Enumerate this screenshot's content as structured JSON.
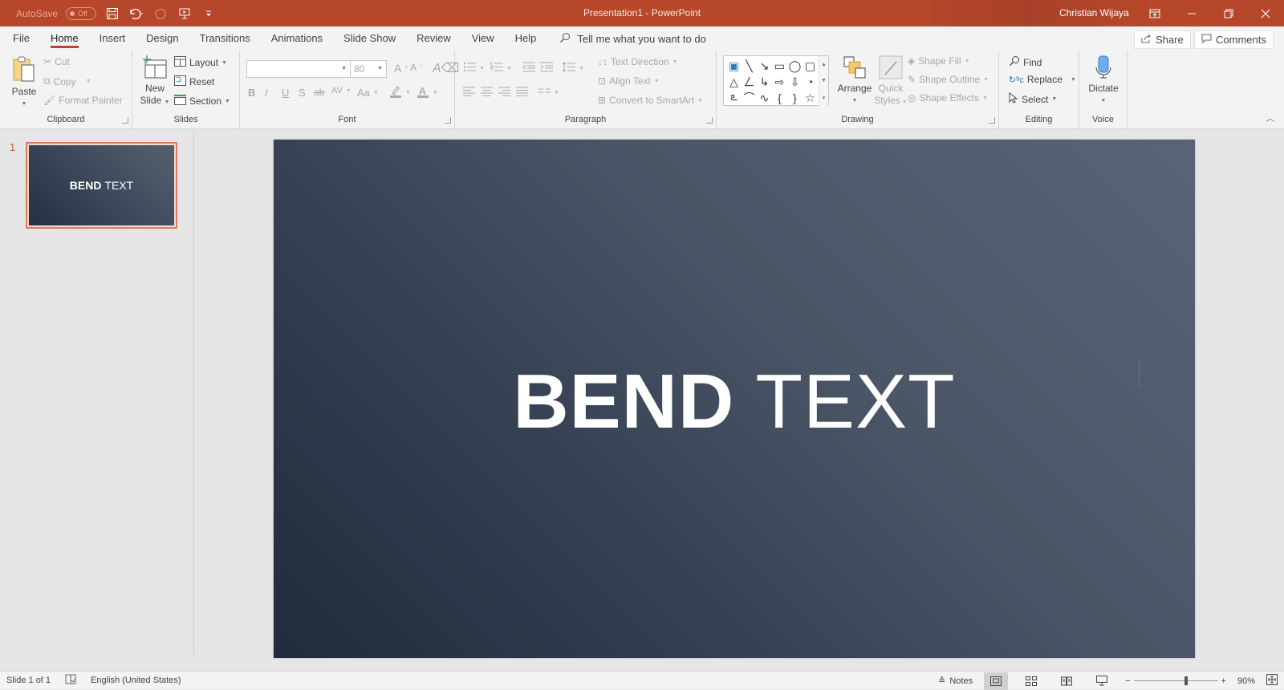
{
  "titlebar": {
    "autosave_label": "AutoSave",
    "autosave_state": "Off",
    "title": "Presentation1  -  PowerPoint",
    "user": "Christian Wijaya",
    "icons": [
      "save-icon",
      "undo-icon",
      "redo-icon",
      "start-from-beginning-icon",
      "customize-qat-icon"
    ],
    "window_controls": [
      "ribbon-display-options-icon",
      "minimize-icon",
      "restore-icon",
      "close-icon"
    ]
  },
  "tabs": [
    {
      "label": "File",
      "active": false
    },
    {
      "label": "Home",
      "active": true
    },
    {
      "label": "Insert",
      "active": false
    },
    {
      "label": "Design",
      "active": false
    },
    {
      "label": "Transitions",
      "active": false
    },
    {
      "label": "Animations",
      "active": false
    },
    {
      "label": "Slide Show",
      "active": false
    },
    {
      "label": "Review",
      "active": false
    },
    {
      "label": "View",
      "active": false
    },
    {
      "label": "Help",
      "active": false
    }
  ],
  "tellme": {
    "placeholder": "Tell me what you want to do"
  },
  "share": {
    "label": "Share"
  },
  "comments": {
    "label": "Comments"
  },
  "ribbon": {
    "clipboard": {
      "label": "Clipboard",
      "paste": "Paste",
      "cut": "Cut",
      "copy": "Copy",
      "format_painter": "Format Painter"
    },
    "slides": {
      "label": "Slides",
      "new_slide_1": "New",
      "new_slide_2": "Slide",
      "layout": "Layout",
      "reset": "Reset",
      "section": "Section"
    },
    "font": {
      "label": "Font",
      "font_name": "",
      "font_size": "80",
      "bold": "B",
      "italic": "I",
      "underline": "U",
      "shadow": "S",
      "strikethrough": "ab",
      "spacing": "AV",
      "change_case": "Aa",
      "grow": "A",
      "shrink": "A"
    },
    "paragraph": {
      "label": "Paragraph",
      "text_direction": "Text Direction",
      "align_text": "Align Text",
      "convert_smartart": "Convert to SmartArt"
    },
    "drawing": {
      "label": "Drawing",
      "arrange": "Arrange",
      "quick_styles_1": "Quick",
      "quick_styles_2": "Styles",
      "shape_fill": "Shape Fill",
      "shape_outline": "Shape Outline",
      "shape_effects": "Shape Effects",
      "shapes": [
        "▣",
        "╲",
        "↘",
        "▭",
        "◯",
        "▢",
        "△",
        "ㄥ",
        "↳",
        "⇨",
        "⇩",
        "◔",
        "ఽ",
        "⌒",
        "∿",
        "{",
        "}",
        "☆"
      ]
    },
    "editing": {
      "label": "Editing",
      "find": "Find",
      "replace": "Replace",
      "select": "Select"
    },
    "voice": {
      "label": "Voice",
      "dictate": "Dictate"
    }
  },
  "thumbnails": [
    {
      "number": "1",
      "title_bold": "BEND",
      "title_regular": "TEXT",
      "selected": true
    }
  ],
  "slide": {
    "title_bold": "BEND",
    "title_regular": "TEXT",
    "bg_dark": "#202b3b",
    "bg_light": "#596476"
  },
  "statusbar": {
    "slide_info": "Slide 1 of 1",
    "language": "English (United States)",
    "notes": "Notes",
    "zoom": "90%",
    "zoom_fraction": 0.6
  },
  "colors": {
    "accent": "#b7472a",
    "thumb_border": "#e07a5f"
  }
}
